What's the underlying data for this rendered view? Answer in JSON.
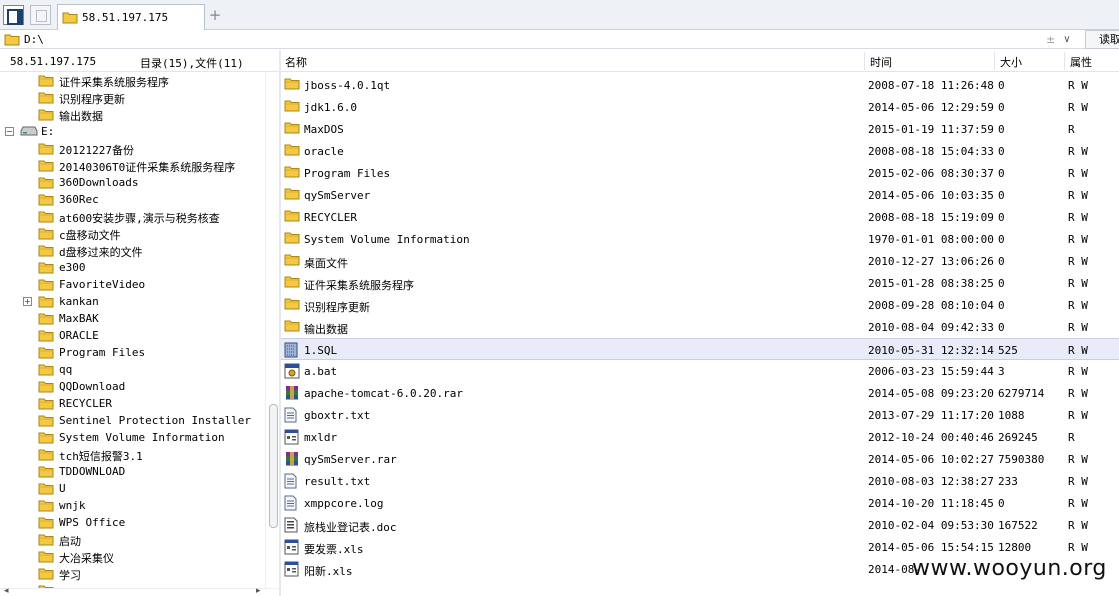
{
  "tab": {
    "title": "58.51.197.175",
    "add_label": "+"
  },
  "address": {
    "path": "D:\\",
    "pin": "±",
    "dropdown": "∨",
    "read_label": "读取"
  },
  "left_header": {
    "host": "58.51.197.175",
    "count_text": "目录(15),文件(11)"
  },
  "tree": {
    "items": [
      {
        "label": "证件采集系统服务程序",
        "icon": "folder-icon",
        "level": 2,
        "expander": ""
      },
      {
        "label": "识别程序更新",
        "icon": "folder-icon",
        "level": 2,
        "expander": ""
      },
      {
        "label": "输出数据",
        "icon": "folder-icon",
        "level": 2,
        "expander": ""
      },
      {
        "label": "E:",
        "icon": "drive-icon",
        "level": 1,
        "expander": "−"
      },
      {
        "label": "20121227备份",
        "icon": "folder-icon",
        "level": 2,
        "expander": ""
      },
      {
        "label": "20140306T0证件采集系统服务程序",
        "icon": "folder-icon",
        "level": 2,
        "expander": ""
      },
      {
        "label": "360Downloads",
        "icon": "folder-icon",
        "level": 2,
        "expander": ""
      },
      {
        "label": "360Rec",
        "icon": "folder-icon",
        "level": 2,
        "expander": ""
      },
      {
        "label": "at600安装步骤,演示与税务核查",
        "icon": "folder-icon",
        "level": 2,
        "expander": ""
      },
      {
        "label": "c盘移动文件",
        "icon": "folder-icon",
        "level": 2,
        "expander": ""
      },
      {
        "label": "d盘移过来的文件",
        "icon": "folder-icon",
        "level": 2,
        "expander": ""
      },
      {
        "label": "e300",
        "icon": "folder-icon",
        "level": 2,
        "expander": ""
      },
      {
        "label": "FavoriteVideo",
        "icon": "folder-icon",
        "level": 2,
        "expander": ""
      },
      {
        "label": "kankan",
        "icon": "folder-icon",
        "level": 2,
        "expander": "+"
      },
      {
        "label": "MaxBAK",
        "icon": "folder-icon",
        "level": 2,
        "expander": ""
      },
      {
        "label": "ORACLE",
        "icon": "folder-icon",
        "level": 2,
        "expander": ""
      },
      {
        "label": "Program Files",
        "icon": "folder-icon",
        "level": 2,
        "expander": ""
      },
      {
        "label": "qq",
        "icon": "folder-icon",
        "level": 2,
        "expander": ""
      },
      {
        "label": "QQDownload",
        "icon": "folder-icon",
        "level": 2,
        "expander": ""
      },
      {
        "label": "RECYCLER",
        "icon": "folder-icon",
        "level": 2,
        "expander": ""
      },
      {
        "label": "Sentinel Protection Installer",
        "icon": "folder-icon",
        "level": 2,
        "expander": ""
      },
      {
        "label": "System Volume Information",
        "icon": "folder-icon",
        "level": 2,
        "expander": ""
      },
      {
        "label": "tch短信报警3.1",
        "icon": "folder-icon",
        "level": 2,
        "expander": ""
      },
      {
        "label": "TDDOWNLOAD",
        "icon": "folder-icon",
        "level": 2,
        "expander": ""
      },
      {
        "label": "U",
        "icon": "folder-icon",
        "level": 2,
        "expander": ""
      },
      {
        "label": "wnjk",
        "icon": "folder-icon",
        "level": 2,
        "expander": ""
      },
      {
        "label": "WPS Office",
        "icon": "folder-icon",
        "level": 2,
        "expander": ""
      },
      {
        "label": "启动",
        "icon": "folder-icon",
        "level": 2,
        "expander": ""
      },
      {
        "label": "大冶采集仪",
        "icon": "folder-icon",
        "level": 2,
        "expander": ""
      },
      {
        "label": "学习",
        "icon": "folder-icon",
        "level": 2,
        "expander": ""
      },
      {
        "label": "",
        "icon": "folder-icon",
        "level": 2,
        "expander": ""
      }
    ]
  },
  "columns": {
    "name": "名称",
    "time": "时间",
    "size": "大小",
    "attr": "属性"
  },
  "files": [
    {
      "name": "jboss-4.0.1qt",
      "time": "2008-07-18 11:26:48",
      "size": "0",
      "attr": "R W",
      "icon": "folder-icon"
    },
    {
      "name": "jdk1.6.0",
      "time": "2014-05-06 12:29:59",
      "size": "0",
      "attr": "R W",
      "icon": "folder-icon"
    },
    {
      "name": "MaxDOS",
      "time": "2015-01-19 11:37:59",
      "size": "0",
      "attr": "R",
      "icon": "folder-icon"
    },
    {
      "name": "oracle",
      "time": "2008-08-18 15:04:33",
      "size": "0",
      "attr": "R W",
      "icon": "folder-icon"
    },
    {
      "name": "Program Files",
      "time": "2015-02-06 08:30:37",
      "size": "0",
      "attr": "R W",
      "icon": "folder-icon"
    },
    {
      "name": "qySmServer",
      "time": "2014-05-06 10:03:35",
      "size": "0",
      "attr": "R W",
      "icon": "folder-icon"
    },
    {
      "name": "RECYCLER",
      "time": "2008-08-18 15:19:09",
      "size": "0",
      "attr": "R W",
      "icon": "folder-icon"
    },
    {
      "name": "System Volume Information",
      "time": "1970-01-01 08:00:00",
      "size": "0",
      "attr": "R W",
      "icon": "folder-icon"
    },
    {
      "name": "桌面文件",
      "time": "2010-12-27 13:06:26",
      "size": "0",
      "attr": "R W",
      "icon": "folder-icon"
    },
    {
      "name": "证件采集系统服务程序",
      "time": "2015-01-28 08:38:25",
      "size": "0",
      "attr": "R W",
      "icon": "folder-icon"
    },
    {
      "name": "识别程序更新",
      "time": "2008-09-28 08:10:04",
      "size": "0",
      "attr": "R W",
      "icon": "folder-icon"
    },
    {
      "name": "输出数据",
      "time": "2010-08-04 09:42:33",
      "size": "0",
      "attr": "R W",
      "icon": "folder-icon"
    },
    {
      "name": "1.SQL",
      "time": "2010-05-31 12:32:14",
      "size": "525",
      "attr": "R W",
      "icon": "sql-file-icon",
      "selected": true
    },
    {
      "name": "a.bat",
      "time": "2006-03-23 15:59:44",
      "size": "3",
      "attr": "R W",
      "icon": "batch-file-icon"
    },
    {
      "name": "apache-tomcat-6.0.20.rar",
      "time": "2014-05-08 09:23:20",
      "size": "6279714",
      "attr": "R W",
      "icon": "rar-file-icon"
    },
    {
      "name": "gboxtr.txt",
      "time": "2013-07-29 11:17:20",
      "size": "1088",
      "attr": "R W",
      "icon": "text-file-icon"
    },
    {
      "name": "mxldr",
      "time": "2012-10-24 00:40:46",
      "size": "269245",
      "attr": "R",
      "icon": "system-file-icon"
    },
    {
      "name": "qySmServer.rar",
      "time": "2014-05-06 10:02:27",
      "size": "7590380",
      "attr": "R W",
      "icon": "rar-file-icon"
    },
    {
      "name": "result.txt",
      "time": "2010-08-03 12:38:27",
      "size": "233",
      "attr": "R W",
      "icon": "text-file-icon"
    },
    {
      "name": "xmppcore.log",
      "time": "2014-10-20 11:18:45",
      "size": "0",
      "attr": "R W",
      "icon": "text-file-icon"
    },
    {
      "name": "旅栈业登记表.doc",
      "time": "2010-02-04 09:53:30",
      "size": "167522",
      "attr": "R W",
      "icon": "doc-file-icon"
    },
    {
      "name": "要发票.xls",
      "time": "2014-05-06 15:54:15",
      "size": "12800",
      "attr": "R W",
      "icon": "system-file-icon"
    },
    {
      "name": "阳新.xls",
      "time": "2014-08-",
      "size": "",
      "attr": "",
      "icon": "system-file-icon"
    }
  ],
  "watermark": "www.wooyun.org",
  "colors": {
    "folder": "#f5c842",
    "selection": "#e8ebf8",
    "accent": "#1d3f6e"
  }
}
